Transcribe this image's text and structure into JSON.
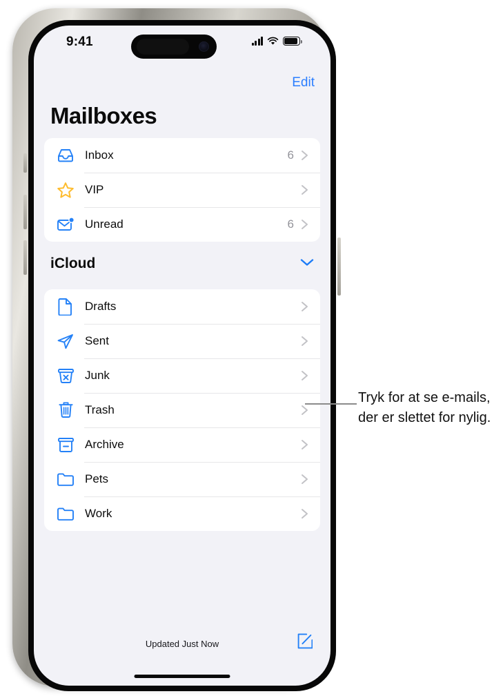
{
  "status_bar": {
    "time": "9:41",
    "cellular_icon": "signal-bars-icon",
    "wifi_icon": "wifi-icon",
    "battery_icon": "battery-icon"
  },
  "nav": {
    "edit_label": "Edit",
    "title": "Mailboxes"
  },
  "primary_mailboxes": [
    {
      "icon": "inbox-tray-icon",
      "label": "Inbox",
      "count": "6"
    },
    {
      "icon": "star-icon",
      "label": "VIP",
      "count": ""
    },
    {
      "icon": "unread-envelope-icon",
      "label": "Unread",
      "count": "6"
    }
  ],
  "icloud_section": {
    "header": "iCloud",
    "collapse_icon": "chevron-down-icon",
    "mailboxes": [
      {
        "icon": "document-icon",
        "label": "Drafts",
        "count": ""
      },
      {
        "icon": "paper-plane-icon",
        "label": "Sent",
        "count": ""
      },
      {
        "icon": "junk-bin-icon",
        "label": "Junk",
        "count": ""
      },
      {
        "icon": "trash-can-icon",
        "label": "Trash",
        "count": ""
      },
      {
        "icon": "archive-box-icon",
        "label": "Archive",
        "count": ""
      },
      {
        "icon": "folder-icon",
        "label": "Pets",
        "count": ""
      },
      {
        "icon": "folder-icon",
        "label": "Work",
        "count": ""
      }
    ]
  },
  "toolbar": {
    "updated_status": "Updated Just Now",
    "compose_icon": "compose-icon"
  },
  "callout": {
    "text": "Tryk for at se e-mails, der er slettet for nylig."
  },
  "colors": {
    "accent_blue": "#2b7eff",
    "icon_blue": "#2481f7",
    "star_yellow": "#febc2e",
    "background": "#F2F2F7",
    "card": "#FFFFFF",
    "chevron_gray": "#c2c2c6",
    "count_gray": "#93939a"
  }
}
